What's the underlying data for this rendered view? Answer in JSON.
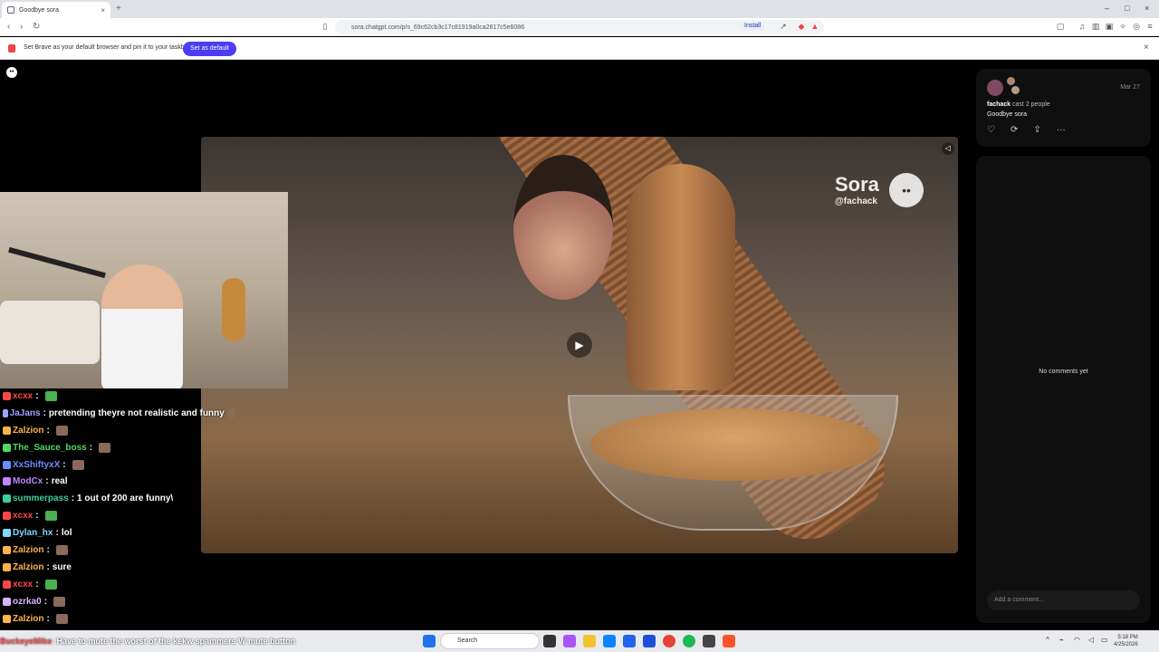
{
  "browser": {
    "tab_title": "Goodbye sora",
    "tab_close": "×",
    "new_tab": "+",
    "url": "sora.chatgpt.com/p/s_69c62cb3c17c81919a0ca2817c5e6086",
    "install_label": "Install",
    "window_controls": [
      "–",
      "□",
      "×"
    ]
  },
  "notification": {
    "message": "Set Brave as your default browser and pin it to your taskbar",
    "button_label": "Set as default",
    "close": "×"
  },
  "video": {
    "watermark_brand": "Sora",
    "watermark_handle": "@fachack"
  },
  "post": {
    "author": "fachack",
    "cast_text": "cast 2 people",
    "date": "Mar 27",
    "caption": "Goodbye sora"
  },
  "comments": {
    "empty_text": "No comments yet",
    "input_placeholder": "Add a comment..."
  },
  "chat": [
    {
      "user": "xcxx",
      "color": "#ff4646",
      "message": ""
    },
    {
      "user": "JaJans",
      "color": "#9aa4ff",
      "message": "pretending theyre not realistic and funny"
    },
    {
      "user": "Zalzion",
      "color": "#ffb347",
      "message": ""
    },
    {
      "user": "The_Sauce_boss",
      "color": "#4cd964",
      "message": ""
    },
    {
      "user": "XxShiftyxX",
      "color": "#6b8cff",
      "message": ""
    },
    {
      "user": "ModCx",
      "color": "#c084fc",
      "message": "real"
    },
    {
      "user": "summerpass",
      "color": "#3ccf9a",
      "message": "1 out of 200 are funny\\"
    },
    {
      "user": "xcxx",
      "color": "#ff4646",
      "message": ""
    },
    {
      "user": "Dylan_hx",
      "color": "#7fd6ff",
      "message": "lol"
    },
    {
      "user": "Zalzion",
      "color": "#ffb347",
      "message": ""
    },
    {
      "user": "Zalzion",
      "color": "#ffb347",
      "message": "sure"
    },
    {
      "user": "xcxx",
      "color": "#ff4646",
      "message": ""
    },
    {
      "user": "ozrka0",
      "color": "#d9b3ff",
      "message": ""
    },
    {
      "user": "Zalzion",
      "color": "#ffb347",
      "message": ""
    }
  ],
  "ticker": {
    "user": "BuckeyeMike",
    "message": "Have to mute the worst of the kekw spammers W mute button"
  },
  "taskbar": {
    "search_label": "Search",
    "time": "5:18 PM",
    "date": "4/25/2026"
  }
}
